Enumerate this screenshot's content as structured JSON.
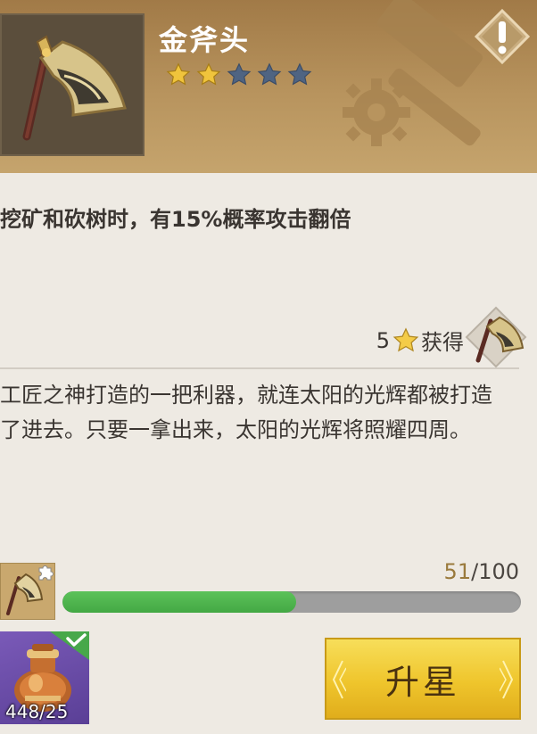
{
  "item": {
    "name": "金斧头",
    "stars_filled": 2,
    "stars_total": 5
  },
  "effect": "挖矿和砍树时，有15%概率攻击翻倍",
  "source": {
    "count": "5",
    "label": "获得"
  },
  "description": "工匠之神打造的一把利器，就连太阳的光辉都被打造了进去。只要一拿出来，太阳的光辉将照耀四周。",
  "progress": {
    "current": "51",
    "separator": "/",
    "max": "100",
    "fraction": 0.51
  },
  "material": {
    "count": "448/25"
  },
  "upgrade_button": {
    "label": "升星"
  },
  "colors": {
    "header_bg": "#b8945e",
    "star_filled": "#f0c43c",
    "star_empty": "#4f6482",
    "progress_fill": "#4fb54d",
    "button": "#efc52c"
  },
  "icons": [
    "golden-axe-icon",
    "star-icon",
    "alert-icon",
    "hammer-gear-icon",
    "puzzle-icon",
    "check-icon",
    "jar-icon"
  ]
}
